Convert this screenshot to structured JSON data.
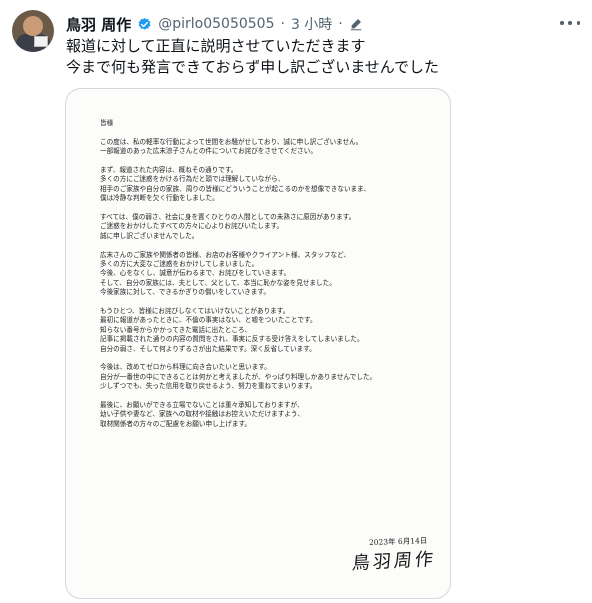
{
  "author": {
    "name": "鳥羽 周作",
    "handle": "@pirlo05050505",
    "separator": "·",
    "time": "3 小時"
  },
  "tweet": {
    "lines": [
      "報道に対して正直に説明させていただきます",
      "今まで何も発言できておらず申し訳ございませんでした"
    ]
  },
  "letter": {
    "salutation": "皆様",
    "paragraphs": [
      [
        "この度は、私の軽率な行動によって世間をお騒がせしており、誠に申し訳ございません。",
        "一部報道のあった広末涼子さんとの件についてお詫びをさせてください。"
      ],
      [
        "まず、報道された内容は、概ねその通りです。",
        "多くの方にご迷惑をかける行為だと頭では理解していながら、",
        "相手のご家族や自分の家族、周りの皆様にどういうことが起こるのかを想像できないまま、",
        "僕は冷静な判断を欠く行動をしました。"
      ],
      [
        "すべては、僕の弱さ、社会に身を置くひとりの人間としての未熟さに原因があります。",
        "ご迷惑をおかけしたすべての方々に心よりお詫びいたします。",
        "誠に申し訳ございませんでした。"
      ],
      [
        "広末さんのご家族や関係者の皆様、お店のお客様やクライアント様、スタッフなど、",
        "多くの方に大変なご迷惑をおかけしてしまいました。",
        "今後、心をなくし、誠意が伝わるまで、お詫びをしていきます。",
        "そして、自分の家族には、夫として、父として、本当に恥かな姿を見せました。",
        "今後家族に対して、できるかぎりの償いをしていきます。"
      ],
      [
        "もうひとつ、皆様にお詫びしなくてはいけないことがあります。",
        "最初に報道があったときに、不倫の事実はない、と嘘をついたことです。",
        "知らない番号からかかってきた電話に出たところ、",
        "記事に掲載された通りの内容の質問をされ、事実に反する受け答えをしてしまいました。",
        "自分の弱さ、そして何よりずるさが出た結果です。深く反省しています。"
      ],
      [
        "今後は、改めてゼロから料理に向き合いたいと思います。",
        "自分が一番世の中にできることは何かと考えましたが、やっぱり料理しかありませんでした。",
        "少しずつでも、失った信用を取り戻せるよう、努力を重ねてまいります。"
      ],
      [
        "最後に、お願いができる立場でないことは重々承知しておりますが、",
        "幼い子供や妻など、家族への取材や接触はお控えいただけますよう、",
        "取材関係者の方々のご配慮をお願い申し上げます。"
      ]
    ],
    "date": "2023年 6月14日",
    "signature": "鳥羽周作"
  }
}
